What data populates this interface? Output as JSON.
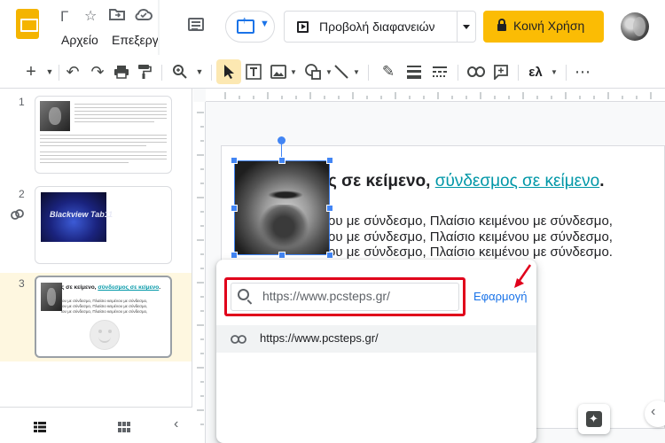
{
  "header": {
    "doc_title": "Γ",
    "menu": {
      "file": "Αρχείο",
      "edit": "Επεξεργ"
    },
    "slideshow_label": "Προβολή διαφανειών",
    "share_label": "Κοινή Χρήση"
  },
  "toolbar": {
    "add": "+",
    "undo": "↶",
    "redo": "↷",
    "print": "⎙",
    "zoom": "⌕",
    "select": "➤",
    "text_box": "T",
    "pen": "✎",
    "input_tools": "ελ",
    "more": "⋯"
  },
  "filmstrip": {
    "slides": [
      {
        "number": "1"
      },
      {
        "number": "2",
        "image_text": "Blackview Tab11"
      },
      {
        "number": "3",
        "title_plain": "ς σε κείμενο, ",
        "title_link": "σύνδεσμος σε κείμενο",
        "title_end": ".",
        "body_line": "ιου με σύνδεσμο, Πλαίσιο κειμένου με σύνδεσμο,"
      }
    ]
  },
  "slide": {
    "title_plain": "ς σε κείμενο, ",
    "title_link": "σύνδεσμος σε κείμενο",
    "title_end": ".",
    "body": [
      "ου με σύνδεσμο, Πλαίσιο κειμένου με σύνδεσμο,",
      "ου με σύνδεσμο, Πλαίσιο κειμένου με σύνδεσμο,",
      "ου με σύνδεσμο, Πλαίσιο κειμένου με σύνδεσμο."
    ]
  },
  "link_popup": {
    "url_value": "https://www.pcsteps.gr/",
    "apply_label": "Εφαρμογή",
    "suggestion": "https://www.pcsteps.gr/"
  },
  "colors": {
    "accent": "#1a73e8",
    "share": "#fbbc04",
    "highlight": "#e0001b",
    "link": "#0097a7"
  }
}
